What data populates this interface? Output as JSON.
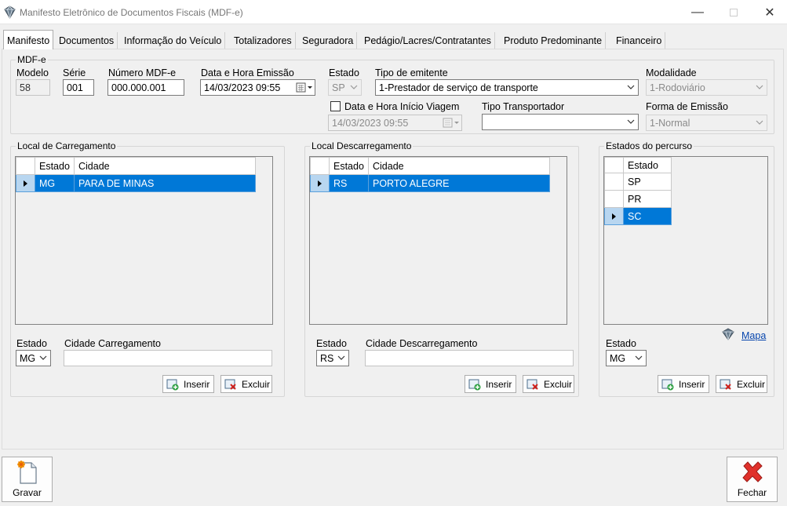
{
  "window": {
    "title": "Manifesto Eletrônico de Documentos Fiscais (MDF-e)"
  },
  "tabs": [
    "Manifesto",
    "Documentos",
    "Informação do Veículo",
    "Totalizadores",
    "Seguradora",
    "Pedágio/Lacres/Contratantes",
    "Produto Predominante",
    "Financeiro"
  ],
  "mdfe": {
    "legend": "MDF-e",
    "modelo_label": "Modelo",
    "modelo": "58",
    "serie_label": "Série",
    "serie": "001",
    "numero_label": "Número MDF-e",
    "numero": "000.000.001",
    "emissao_label": "Data e Hora Emissão",
    "emissao": "14/03/2023 09:55",
    "estado_label": "Estado",
    "estado": "SP",
    "tipo_emitente_label": "Tipo de emitente",
    "tipo_emitente": "1-Prestador de serviço de transporte",
    "modalidade_label": "Modalidade",
    "modalidade": "1-Rodoviário",
    "inicio_viagem_label": "Data e Hora Início Viagem",
    "inicio_viagem": "14/03/2023 09:55",
    "tipo_transportador_label": "Tipo Transportador",
    "tipo_transportador": "",
    "forma_emissao_label": "Forma de Emissão",
    "forma_emissao": "1-Normal"
  },
  "carregamento": {
    "legend": "Local de Carregamento",
    "columns": [
      "Estado",
      "Cidade"
    ],
    "rows": [
      {
        "estado": "MG",
        "cidade": "PARA DE MINAS"
      }
    ],
    "estado_label": "Estado",
    "estado": "MG",
    "cidade_label": "Cidade Carregamento",
    "cidade": "",
    "inserir": "Inserir",
    "excluir": "Excluir"
  },
  "descarregamento": {
    "legend": "Local Descarregamento",
    "columns": [
      "Estado",
      "Cidade"
    ],
    "rows": [
      {
        "estado": "RS",
        "cidade": "PORTO ALEGRE"
      }
    ],
    "estado_label": "Estado",
    "estado": "RS",
    "cidade_label": "Cidade Descarregamento",
    "cidade": "",
    "inserir": "Inserir",
    "excluir": "Excluir"
  },
  "percurso": {
    "legend": "Estados do percurso",
    "column": "Estado",
    "rows": [
      "SP",
      "PR",
      "SC"
    ],
    "mapa": "Mapa",
    "estado_label": "Estado",
    "estado": "MG",
    "inserir": "Inserir",
    "excluir": "Excluir"
  },
  "footer": {
    "gravar": "Gravar",
    "fechar": "Fechar"
  },
  "colors": {
    "selection": "#0078d7",
    "link": "#0645ad",
    "close_red": "#e0312b"
  }
}
